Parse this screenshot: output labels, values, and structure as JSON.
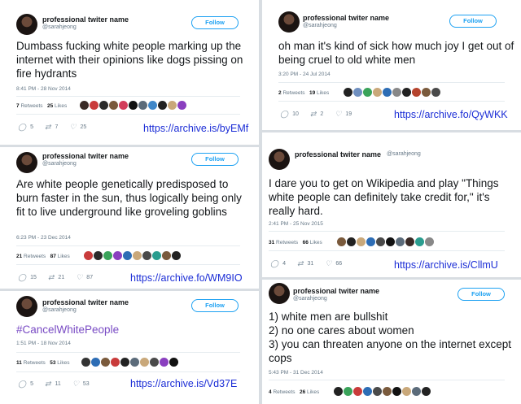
{
  "colors": {
    "follow": "#1da1f2",
    "link": "#1b2dd6",
    "hashtag": "#794bc4",
    "muted": "#657786"
  },
  "icons": {
    "reply": "reply-icon",
    "retweet": "retweet-icon",
    "like": "heart-icon"
  },
  "tweets": [
    {
      "name": "professional twiter name",
      "handle": "@sarahjeong",
      "follow": "Follow",
      "text": "Dumbass fucking white people marking up the internet with their opinions like dogs pissing on fire hydrants",
      "time": "8:41 PM - 28 Nov 2014",
      "retweets_label": "Retweets",
      "retweets": "7",
      "likes_label": "Likes",
      "likes": "25",
      "reply": "5",
      "rt": "7",
      "fav": "25",
      "archive": "https://archive.is/byEMf",
      "likers": [
        "#3a2a26",
        "#c93b3b",
        "#2b2b2b",
        "#7a5a3c",
        "#d23c5a",
        "#111",
        "#5b6b7a",
        "#3f87c9",
        "#222",
        "#c9a87a",
        "#8a3fbf"
      ]
    },
    {
      "name": "professional twiter name",
      "handle": "@sarahjeong",
      "follow": "Follow",
      "text": "oh man it's kind of sick how much joy I get out of being cruel to old white men",
      "time": "3:20 PM - 24 Jul 2014",
      "retweets_label": "Retweets",
      "retweets": "2",
      "likes_label": "Likes",
      "likes": "19",
      "reply": "10",
      "rt": "2",
      "fav": "19",
      "archive": "https://archive.fo/QyWKK",
      "likers": [
        "#222",
        "#6f8fbf",
        "#3aa35a",
        "#c9a87a",
        "#2d6db5",
        "#888",
        "#222",
        "#b5432d",
        "#7a5a3c",
        "#4a4a4a"
      ]
    },
    {
      "name": "professional twiter name",
      "handle": "@sarahjeong",
      "follow": "Follow",
      "text": "Are white people genetically predisposed to burn faster in the sun, thus logically being only fit to live underground like groveling goblins",
      "time": "6:23 PM - 23 Dec 2014",
      "retweets_label": "Retweets",
      "retweets": "21",
      "likes_label": "Likes",
      "likes": "87",
      "reply": "15",
      "rt": "21",
      "fav": "87",
      "archive": "https://archive.fo/WM9IO",
      "likers": [
        "#c93b3b",
        "#2b2b2b",
        "#3aa35a",
        "#8a3fbf",
        "#2d6db5",
        "#c9a87a",
        "#4a4a4a",
        "#2a9d8f",
        "#7a5a3c",
        "#222"
      ]
    },
    {
      "name": "professional twiter name",
      "handle": "@sarahjeong",
      "follow": "Follow",
      "text": "#CancelWhitePeople",
      "time": "1:51 PM - 18 Nov 2014",
      "retweets_label": "Retweets",
      "retweets": "11",
      "likes_label": "Likes",
      "likes": "53",
      "reply": "5",
      "rt": "11",
      "fav": "53",
      "archive": "https://archive.is/Vd37E",
      "likers": [
        "#333",
        "#2d6db5",
        "#7a5a3c",
        "#c93b3b",
        "#222",
        "#5b6b7a",
        "#c9a87a",
        "#4a4a4a",
        "#8a3fbf",
        "#111"
      ]
    },
    {
      "name": "professional twiter name",
      "handle": "@sarahjeong",
      "text": "I dare you to get on Wikipedia and play \"Things white people can definitely take credit for,\" it's really hard.",
      "time": "2:41 PM - 25 Nov 2015",
      "retweets_label": "Retweets",
      "retweets": "31",
      "likes_label": "Likes",
      "likes": "66",
      "reply": "4",
      "rt": "31",
      "fav": "66",
      "archive": "https://archive.is/CllmU",
      "likers": [
        "#7a5a3c",
        "#222",
        "#c9a87a",
        "#2d6db5",
        "#4a4a4a",
        "#111",
        "#5b6b7a",
        "#3a2a26",
        "#2a9d8f",
        "#888"
      ]
    },
    {
      "name": "professional twiter name",
      "handle": "@sarahjeong",
      "follow": "Follow",
      "text_lines": [
        "1) white men are bullshit",
        "2) no one cares about women",
        "3) you can threaten anyone on the internet except cops"
      ],
      "time": "5:43 PM - 31 Dec 2014",
      "retweets_label": "Retweets",
      "retweets": "4",
      "likes_label": "Likes",
      "likes": "26",
      "likers": [
        "#222",
        "#3aa35a",
        "#c93b3b",
        "#2d6db5",
        "#4a4a4a",
        "#7a5a3c",
        "#111",
        "#c9a87a",
        "#5b6b7a",
        "#222"
      ]
    }
  ]
}
